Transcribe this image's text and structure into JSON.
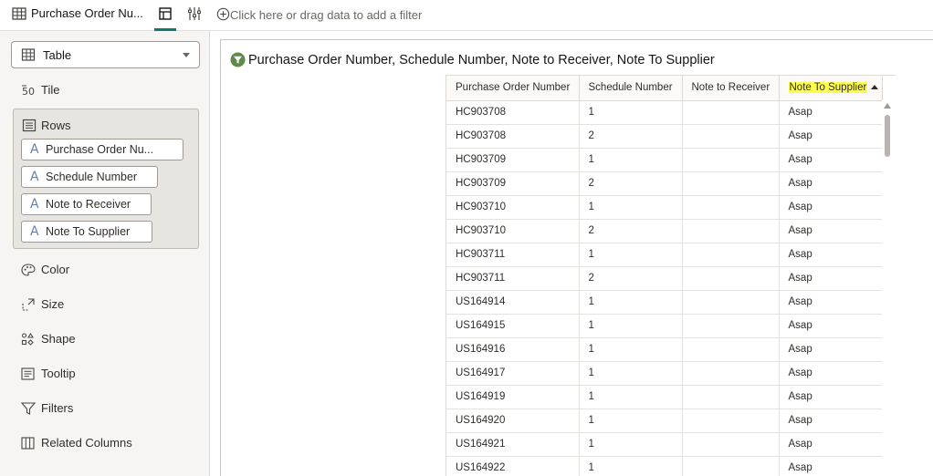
{
  "panel": {
    "title": "Purchase Order Nu...",
    "viz_type": "Table",
    "grammar": {
      "tile": "Tile",
      "rows": "Rows",
      "color": "Color",
      "size": "Size",
      "shape": "Shape",
      "tooltip": "Tooltip",
      "filters": "Filters",
      "related_columns": "Related Columns"
    },
    "row_pills": [
      "Purchase Order Nu...",
      "Schedule Number",
      "Note to Receiver",
      "Note To Supplier"
    ]
  },
  "filter_bar": {
    "placeholder": "Click here or drag data to add a filter"
  },
  "viz": {
    "title": "Purchase Order Number, Schedule Number, Note to Receiver, Note To Supplier",
    "columns": [
      "Purchase Order Number",
      "Schedule Number",
      "Note to Receiver",
      "Note To Supplier"
    ],
    "rows": [
      [
        "HC903708",
        "1",
        "",
        "Asap"
      ],
      [
        "HC903708",
        "2",
        "",
        "Asap"
      ],
      [
        "HC903709",
        "1",
        "",
        "Asap"
      ],
      [
        "HC903709",
        "2",
        "",
        "Asap"
      ],
      [
        "HC903710",
        "1",
        "",
        "Asap"
      ],
      [
        "HC903710",
        "2",
        "",
        "Asap"
      ],
      [
        "HC903711",
        "1",
        "",
        "Asap"
      ],
      [
        "HC903711",
        "2",
        "",
        "Asap"
      ],
      [
        "US164914",
        "1",
        "",
        "Asap"
      ],
      [
        "US164915",
        "1",
        "",
        "Asap"
      ],
      [
        "US164916",
        "1",
        "",
        "Asap"
      ],
      [
        "US164917",
        "1",
        "",
        "Asap"
      ],
      [
        "US164919",
        "1",
        "",
        "Asap"
      ],
      [
        "US164920",
        "1",
        "",
        "Asap"
      ],
      [
        "US164921",
        "1",
        "",
        "Asap"
      ],
      [
        "US164922",
        "1",
        "",
        "Asap"
      ]
    ]
  },
  "colors": {
    "accent": "#0b7a77",
    "highlight": "#ffff4d",
    "filter_icon": "#5e8a4a"
  }
}
